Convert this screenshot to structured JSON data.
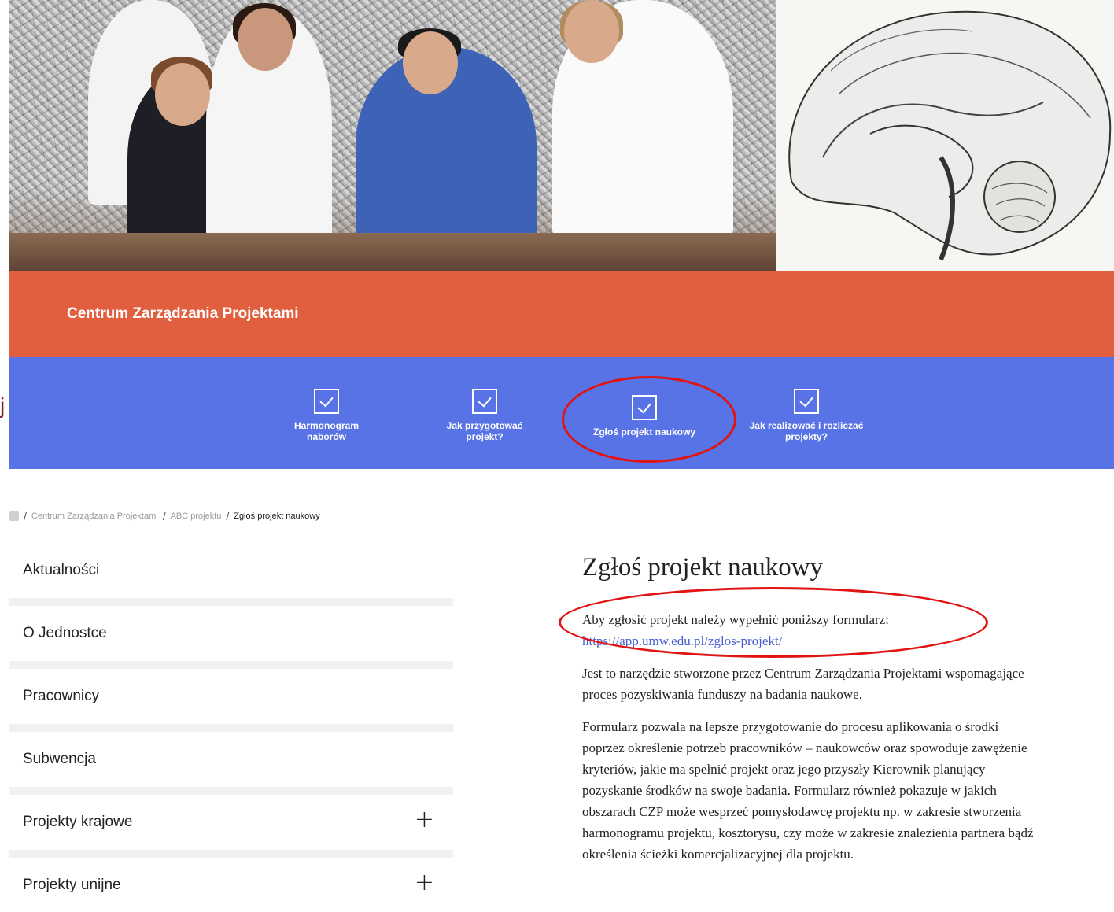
{
  "site": {
    "title": "Centrum Zarządzania Projektami"
  },
  "nav": {
    "items": [
      {
        "label": "Harmonogram naborów",
        "icon": "checkbox-icon"
      },
      {
        "label": "Jak przygotować projekt?",
        "icon": "checkbox-icon"
      },
      {
        "label": "Zgłoś projekt naukowy",
        "icon": "checkbox-icon"
      },
      {
        "label": "Jak realizować i rozliczać projekty?",
        "icon": "checkbox-icon"
      }
    ]
  },
  "breadcrumb": {
    "items": [
      "Centrum Zarządzania Projektami",
      "ABC projektu"
    ],
    "current": "Zgłoś projekt naukowy",
    "separator": "/"
  },
  "sidebar": {
    "items": [
      {
        "label": "Aktualności",
        "expandable": false
      },
      {
        "label": "O Jednostce",
        "expandable": false
      },
      {
        "label": "Pracownicy",
        "expandable": false
      },
      {
        "label": "Subwencja",
        "expandable": false
      },
      {
        "label": "Projekty krajowe",
        "expandable": true,
        "toggle": "+"
      },
      {
        "label": "Projekty unijne",
        "expandable": true,
        "toggle": "+"
      }
    ]
  },
  "main": {
    "title": "Zgłoś projekt naukowy",
    "intro": "Aby zgłosić projekt należy wypełnić poniższy formularz:",
    "link": "https://app.umw.edu.pl/zglos-projekt/",
    "paragraph2": "Jest to narzędzie stworzone przez Centrum Zarządzania Projektami wspomagające proces pozyskiwania funduszy na badania naukowe.",
    "paragraph3": "Formularz pozwala na lepsze przygotowanie do procesu aplikowania o środki poprzez określenie potrzeb pracowników – naukowców oraz spowoduje zawężenie kryteriów, jakie ma spełnić projekt oraz jego przyszły Kierownik planujący pozyskanie środków na swoje badania. Formularz również pokazuje w jakich obszarach CZP może wesprzeć pomysłodawcę projektu np. w zakresie stworzenia harmonogramu projektu, kosztorysu, czy może w zakresie znalezienia partnera bądź określenia ścieżki komercjalizacyjnej dla projektu."
  },
  "colors": {
    "title_band": "#e15f3f",
    "nav_band": "#5873e5",
    "highlight": "#e11414",
    "link": "#4a5fd0"
  }
}
